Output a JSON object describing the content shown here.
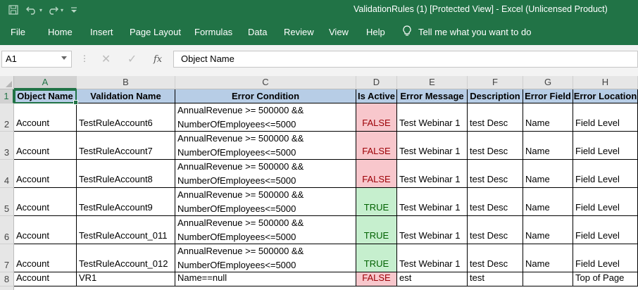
{
  "app": {
    "title": "ValidationRules (1)  [Protected View]  -  Excel (Unlicensed Product)",
    "accent": "#217346"
  },
  "quick_access": [
    "save-icon",
    "undo-icon",
    "redo-icon",
    "customize-icon"
  ],
  "ribbon": {
    "tabs": [
      "File",
      "Home",
      "Insert",
      "Page Layout",
      "Formulas",
      "Data",
      "Review",
      "View",
      "Help"
    ],
    "tell_me": "Tell me what you want to do"
  },
  "formula_bar": {
    "name_box": "A1",
    "formula": "Object Name"
  },
  "columns": [
    "A",
    "B",
    "C",
    "D",
    "E",
    "F",
    "G",
    "H"
  ],
  "rows": [
    "1",
    "2",
    "3",
    "4",
    "5",
    "6",
    "7",
    "8"
  ],
  "headers": [
    "Object Name",
    "Validation Name",
    "Error Condition",
    "Is Active",
    "Error Message",
    "Description",
    "Error Field",
    "Error Location"
  ],
  "data": [
    {
      "object": "Account",
      "name": "TestRuleAccount6",
      "cond1": "AnnualRevenue >= 500000 &&",
      "cond2": "NumberOfEmployees<=5000",
      "active": "FALSE",
      "message": "Test Webinar 1",
      "desc": "test Desc",
      "field": "Name",
      "location": "Field Level"
    },
    {
      "object": "Account",
      "name": "TestRuleAccount7",
      "cond1": "AnnualRevenue >= 500000 &&",
      "cond2": "NumberOfEmployees<=5000",
      "active": "FALSE",
      "message": "Test Webinar 1",
      "desc": "test Desc",
      "field": "Name",
      "location": "Field Level"
    },
    {
      "object": "Account",
      "name": "TestRuleAccount8",
      "cond1": "AnnualRevenue >= 500000 &&",
      "cond2": "NumberOfEmployees<=5000",
      "active": "FALSE",
      "message": "Test Webinar 1",
      "desc": "test Desc",
      "field": "Name",
      "location": "Field Level"
    },
    {
      "object": "Account",
      "name": "TestRuleAccount9",
      "cond1": "AnnualRevenue >= 500000 &&",
      "cond2": "NumberOfEmployees<=5000",
      "active": "TRUE",
      "message": "Test Webinar 1",
      "desc": "test Desc",
      "field": "Name",
      "location": "Field Level"
    },
    {
      "object": "Account",
      "name": "TestRuleAccount_011",
      "cond1": "AnnualRevenue >= 500000 &&",
      "cond2": "NumberOfEmployees<=5000",
      "active": "TRUE",
      "message": "Test Webinar 1",
      "desc": "test Desc",
      "field": "Name",
      "location": "Field Level"
    },
    {
      "object": "Account",
      "name": "TestRuleAccount_012",
      "cond1": "AnnualRevenue >= 500000 &&",
      "cond2": "NumberOfEmployees<=5000",
      "active": "TRUE",
      "message": "Test Webinar 1",
      "desc": "test Desc",
      "field": "Name",
      "location": "Field Level"
    },
    {
      "object": "Account",
      "name": "VR1",
      "cond1": "",
      "cond2": "Name==null",
      "active": "FALSE",
      "message": "est",
      "desc": "test",
      "field": "",
      "location": "Top of Page"
    }
  ],
  "colors": {
    "header_fill": "#b7cde6",
    "false_fill": "#f8c7cc",
    "false_text": "#9c0006",
    "true_fill": "#c6efce",
    "true_text": "#006100"
  }
}
